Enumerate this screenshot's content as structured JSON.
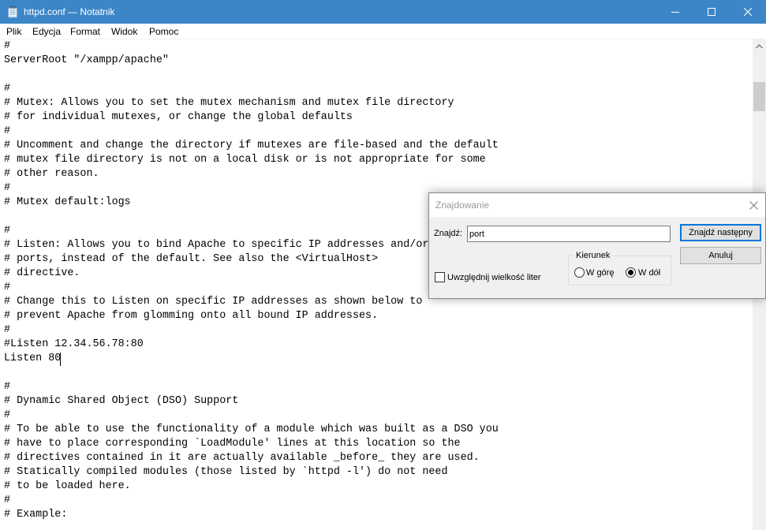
{
  "window": {
    "title": "httpd.conf — Notatnik",
    "icon": "notepad-icon"
  },
  "menu": [
    "Plik",
    "Edycja",
    "Format",
    "Widok",
    "Pomoc"
  ],
  "editor": {
    "lines": [
      "#",
      "ServerRoot \"/xampp/apache\"",
      "",
      "#",
      "# Mutex: Allows you to set the mutex mechanism and mutex file directory",
      "# for individual mutexes, or change the global defaults",
      "#",
      "# Uncomment and change the directory if mutexes are file-based and the default",
      "# mutex file directory is not on a local disk or is not appropriate for some",
      "# other reason.",
      "#",
      "# Mutex default:logs",
      "",
      "#",
      "# Listen: Allows you to bind Apache to specific IP addresses and/or",
      "# ports, instead of the default. See also the <VirtualHost>",
      "# directive.",
      "#",
      "# Change this to Listen on specific IP addresses as shown below to",
      "# prevent Apache from glomming onto all bound IP addresses.",
      "#",
      "#Listen 12.34.56.78:80",
      "Listen 80",
      "",
      "#",
      "# Dynamic Shared Object (DSO) Support",
      "#",
      "# To be able to use the functionality of a module which was built as a DSO you",
      "# have to place corresponding `LoadModule' lines at this location so the",
      "# directives contained in it are actually available _before_ they are used.",
      "# Statically compiled modules (those listed by `httpd -l') do not need",
      "# to be loaded here.",
      "#",
      "# Example:"
    ]
  },
  "find_dialog": {
    "title": "Znajdowanie",
    "find_label": "Znajdź:",
    "find_value": "port",
    "find_next_button": "Znajdź następny",
    "cancel_button": "Anuluj",
    "direction_group": "Kierunek",
    "direction_up": "W górę",
    "direction_down": "W dół",
    "direction_selected": "down",
    "match_case_label": "Uwzględnij wielkość liter",
    "match_case_checked": false
  },
  "colors": {
    "titlebar": "#3c86c8",
    "dialog_bg": "#f0f0f0",
    "accent": "#0078d7"
  }
}
